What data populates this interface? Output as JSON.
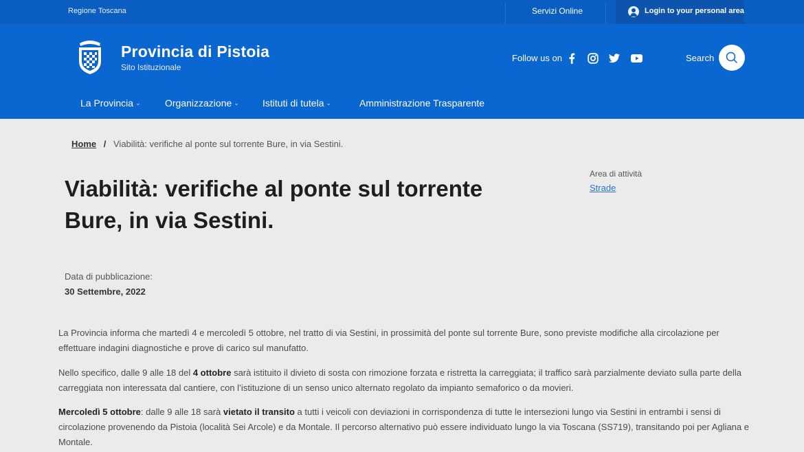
{
  "topbar": {
    "region": "Regione Toscana",
    "services": "Servizi Online",
    "login": "Login to your personal area"
  },
  "header": {
    "title": "Provincia di Pistoia",
    "subtitle": "Sito Istituzionale",
    "follow": "Follow us on",
    "social_icons": [
      "facebook-icon",
      "instagram-icon",
      "twitter-icon",
      "youtube-icon"
    ],
    "search": "Search"
  },
  "nav": {
    "items": [
      {
        "label": "La Provincia"
      },
      {
        "label": "Organizzazione"
      },
      {
        "label": "Istituti di tutela"
      },
      {
        "label": "Amministrazione Trasparente"
      }
    ]
  },
  "breadcrumb": {
    "home": "Home",
    "separator": "/",
    "current": "Viabilità: verifiche al ponte sul torrente Bure, in via Sestini."
  },
  "article": {
    "title": "Viabilità: verifiche al ponte sul torrente Bure, in via Sestini.",
    "area_label": "Area di attività",
    "area_link": "Strade",
    "date_label": "Data di pubblicazione:",
    "date_value": "30 Settembre, 2022",
    "p1": "La Provincia informa che martedì 4 e mercoledì 5 ottobre, nel tratto di via Sestini, in prossimità del ponte sul torrente Bure, sono previste modifiche alla circolazione per effettuare indagini diagnostiche e prove di carico sul manufatto.",
    "p2_a": "Nello specifico, dalle 9 alle 18 del ",
    "p2_b": "4 ottobre",
    "p2_c": " sarà istituito il divieto di sosta con rimozione forzata e ristretta la carreggiata; il traffico sarà parzialmente deviato sulla parte della carreggiata non interessata dal cantiere, con l’istituzione di un senso unico alternato regolato da impianto semaforico o da movieri.",
    "p3_a": "Mercoledì 5 ottobre",
    "p3_b": ": dalle 9 alle 18 sarà ",
    "p3_c": "vietato il transito",
    "p3_d": " a tutti i veicoli con deviazioni in corrispondenza di tutte le intersezioni lungo via Sestini in entrambi i sensi di circolazione provenendo da Pistoia (località Sei Arcole) e da Montale. Il percorso alternativo può essere individuato lungo la via Toscana (SS719), transitando poi per Agliana e Montale."
  },
  "colors": {
    "brand_blue": "#0a66d0",
    "topbar_blue": "#0a5ec2",
    "page_bg": "#ebebeb",
    "link": "#2e73c7"
  }
}
